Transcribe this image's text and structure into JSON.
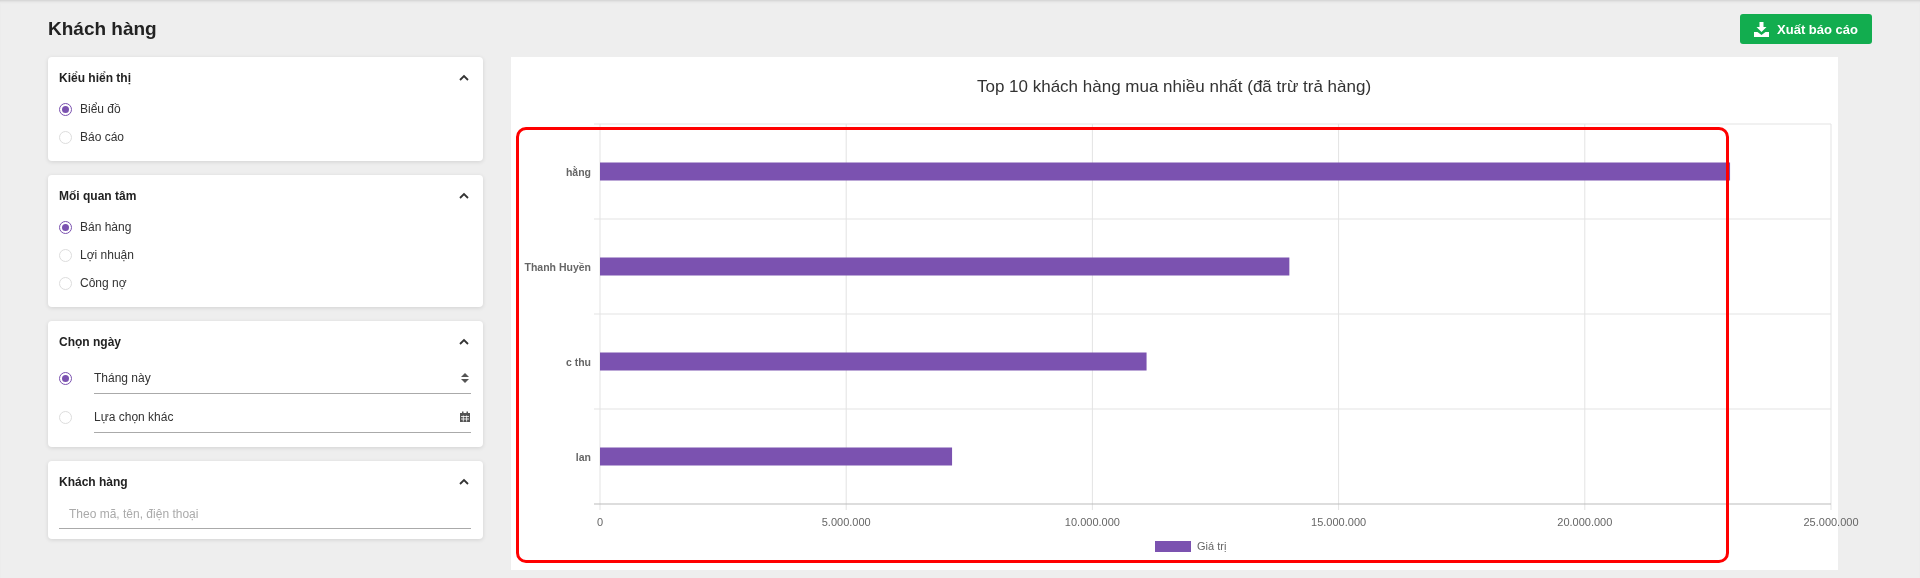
{
  "page": {
    "title": "Khách hàng",
    "export_button": "Xuất báo cáo"
  },
  "filters": [
    {
      "kind": "radios",
      "title": "Kiểu hiển thị",
      "expanded": true,
      "options": [
        {
          "label": "Biểu đồ",
          "selected": true
        },
        {
          "label": "Báo cáo",
          "selected": false
        }
      ]
    },
    {
      "kind": "radios",
      "title": "Mối quan tâm",
      "expanded": true,
      "options": [
        {
          "label": "Bán hàng",
          "selected": true
        },
        {
          "label": "Lợi nhuận",
          "selected": false
        },
        {
          "label": "Công nợ",
          "selected": false
        }
      ]
    },
    {
      "kind": "date",
      "title": "Chọn ngày",
      "expanded": true,
      "options": [
        {
          "label": "Tháng này",
          "selected": true,
          "kind": "select"
        },
        {
          "label": "Lựa chọn khác",
          "selected": false,
          "kind": "calendar"
        }
      ]
    },
    {
      "kind": "search",
      "title": "Khách hàng",
      "expanded": true,
      "placeholder": "Theo mã, tên, điện thoại"
    }
  ],
  "chart": {
    "highlighted": true,
    "chart_data": {
      "type": "bar",
      "orientation": "horizontal",
      "title": "Top 10 khách hàng mua nhiều nhất (đã trừ trả hàng)",
      "categories": [
        "hằng",
        "Thanh Huyền",
        "c thu",
        "lan"
      ],
      "series": [
        {
          "name": "Giá trị",
          "color": "#7b52b0",
          "values": [
            22950000,
            14000000,
            11100000,
            7150000
          ]
        }
      ],
      "xlim": [
        0,
        25000000
      ],
      "grid": true,
      "xticks": [
        {
          "value": 0,
          "label": "0"
        },
        {
          "value": 5000000,
          "label": "5.000.000"
        },
        {
          "value": 10000000,
          "label": "10.000.000"
        },
        {
          "value": 15000000,
          "label": "15.000.000"
        },
        {
          "value": 20000000,
          "label": "20.000.000"
        },
        {
          "value": 25000000,
          "label": "25.000.000"
        }
      ]
    }
  }
}
